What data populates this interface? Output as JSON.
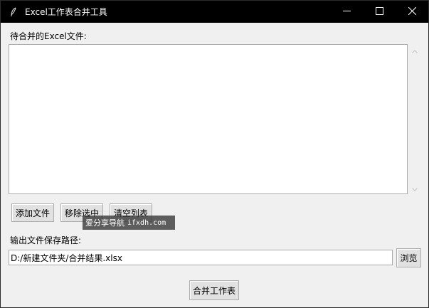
{
  "window": {
    "title": "Excel工作表合并工具"
  },
  "file_list": {
    "label": "待合并的Excel文件:",
    "items": []
  },
  "buttons": {
    "add": "添加文件",
    "remove": "移除选中",
    "clear": "清空列表",
    "browse": "浏览",
    "merge": "合并工作表"
  },
  "output": {
    "label": "输出文件保存路径:",
    "path_value": "D:/新建文件夹/合并结果.xlsx"
  },
  "watermark": {
    "text": "爱分享导航",
    "url": "ifxdh.com"
  },
  "icons": {
    "app": "feather-icon",
    "minimize": "minimize-icon",
    "maximize": "maximize-icon",
    "close": "close-icon",
    "scroll_up": "chevron-up-icon",
    "scroll_down": "chevron-down-icon"
  }
}
